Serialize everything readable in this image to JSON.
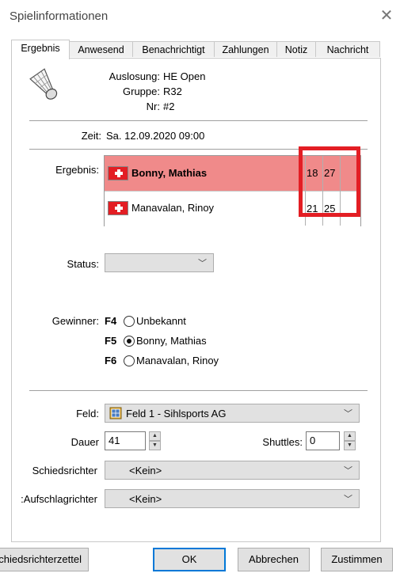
{
  "window": {
    "title": "Spielinformationen"
  },
  "tabs": [
    "Ergebnis",
    "Anwesend",
    "Benachrichtigt",
    "Zahlungen",
    "Notiz",
    "Nachricht"
  ],
  "icons": {
    "close": "close-icon",
    "shuttlecock": "shuttlecock-icon",
    "flag": "swiss-flag-icon",
    "court": "court-icon"
  },
  "match": {
    "draw_label": "Auslosung:",
    "draw_value": "HE Open",
    "group_label": "Gruppe:",
    "group_value": "R32",
    "number_label": "Nr:",
    "number_value": "#2",
    "time_label": "Zeit:",
    "time_value": "Sa. 12.09.2020 09:00"
  },
  "result": {
    "label": "Ergebnis:",
    "players": [
      {
        "name": "Bonny, Mathias",
        "scores": [
          "18",
          "27",
          ""
        ],
        "winner": true
      },
      {
        "name": "Manavalan, Rinoy",
        "scores": [
          "21",
          "25",
          ""
        ],
        "winner": false
      }
    ]
  },
  "status": {
    "label": "Status:",
    "value": ""
  },
  "winner": {
    "label": "Gewinner:",
    "options": [
      {
        "key": "F4",
        "label": "Unbekannt",
        "selected": false
      },
      {
        "key": "F5",
        "label": "Bonny, Mathias",
        "selected": true
      },
      {
        "key": "F6",
        "label": "Manavalan, Rinoy",
        "selected": false
      }
    ]
  },
  "court": {
    "label": "Feld:",
    "value": "Feld 1 - Sihlsports AG"
  },
  "duration": {
    "label": "Dauer",
    "value": "41"
  },
  "shuttles": {
    "label": "Shuttles:",
    "value": "0"
  },
  "umpire": {
    "label": "Schiedsrichter",
    "value": "<Kein>"
  },
  "service_judge": {
    "label": "Aufschlagrichter:",
    "value": "<Kein>"
  },
  "buttons": {
    "umpire_sheet": "Schiedsrichterzettel",
    "ok": "OK",
    "cancel": "Abbrechen",
    "accept": "Zustimmen"
  },
  "colors": {
    "winner_row": "#f08a8a",
    "highlight": "#e31e24",
    "flag_red": "#e31e24"
  }
}
